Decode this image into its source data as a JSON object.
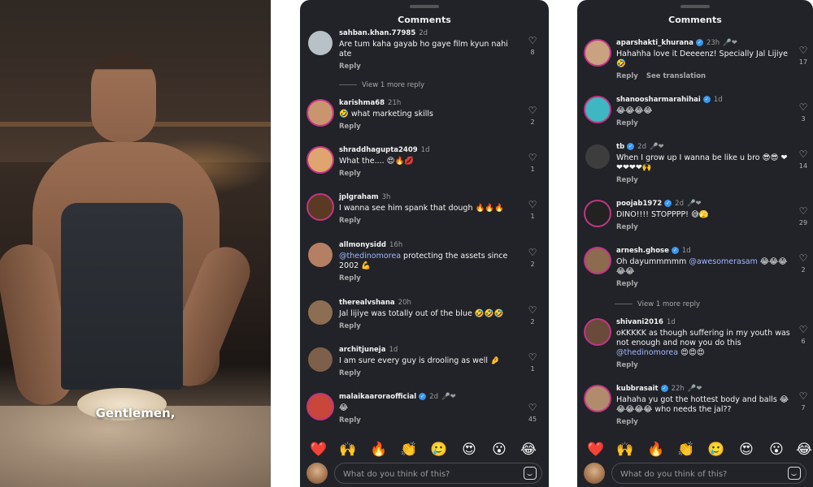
{
  "video": {
    "caption": "Gentlemen,"
  },
  "left_panel": {
    "title": "Comments",
    "comments": [
      {
        "user": "sahban.khan.77985",
        "time": "2d",
        "text": "Are tum kaha gayab ho gaye film kyun nahi ate",
        "reply": "Reply",
        "likes": "8",
        "avatar_color": "#b8c0c8"
      },
      {
        "user": "karishma68",
        "time": "21h",
        "text": "🤣 what marketing skills",
        "reply": "Reply",
        "likes": "2",
        "avatar_color": "#c9956f"
      },
      {
        "user": "shraddhagupta2409",
        "time": "1d",
        "text": "What the.... 😍🔥💋",
        "reply": "Reply",
        "likes": "1",
        "avatar_color": "#e0a46e"
      },
      {
        "user": "jplgraham",
        "time": "3h",
        "text": "I wanna see him spank that dough 🔥🔥🔥",
        "reply": "Reply",
        "likes": "1",
        "avatar_color": "#5a3a22"
      },
      {
        "user": "allmonysidd",
        "time": "16h",
        "mention": "@thedinomorea",
        "text": " protecting the assets since 2002 💪",
        "reply": "Reply",
        "likes": "2",
        "avatar_color": "#b57f63"
      },
      {
        "user": "therealvshana",
        "time": "20h",
        "text": "Jal lijiye was totally out of the blue 🤣🤣🤣",
        "reply": "Reply",
        "likes": "2",
        "avatar_color": "#8d6e53"
      },
      {
        "user": "architjuneja",
        "time": "1d",
        "text": "I am sure every guy is drooling as well 🤌",
        "reply": "Reply",
        "likes": "1",
        "avatar_color": "#7e5f4a"
      },
      {
        "user": "malaikaaroraofficial",
        "time": "2d",
        "badge": "🎤❤",
        "text": "😂",
        "reply": "Reply",
        "likes": "45",
        "avatar_color": "#c8463a"
      }
    ],
    "view_more": "View 1 more reply"
  },
  "right_panel": {
    "title": "Comments",
    "comments": [
      {
        "user": "aparshakti_khurana",
        "time": "23h",
        "badge": "🎤❤",
        "text": "Hahahha love it Deeeenz! Specially Jal Lijiye 🤣",
        "reply": "Reply",
        "translate": "See translation",
        "likes": "17",
        "avatar_color": "#c9a27f"
      },
      {
        "user": "shanoosharmarahihai",
        "time": "1d",
        "text": "😂😂😂😂",
        "reply": "Reply",
        "likes": "3",
        "avatar_color": "#3fb7c2"
      },
      {
        "user": "tb",
        "time": "2d",
        "badge": "🎤❤",
        "text": "When I grow up I wanna be like u bro 😎😎 ❤❤❤❤❤🙌",
        "reply": "Reply",
        "likes": "14",
        "avatar_color": "#3d3d3d"
      },
      {
        "user": "poojab1972",
        "time": "2d",
        "badge": "🎤❤",
        "text": "DINO!!!! STOPPPP! 😅🫣",
        "reply": "Reply",
        "likes": "29",
        "avatar_color": "#222222"
      },
      {
        "user": "arnesh.ghose",
        "time": "1d",
        "mention": "@awesomerasam",
        "text_before": "Oh dayummmmm ",
        "text": " 😂😂😂😂😂",
        "reply": "Reply",
        "likes": "2",
        "avatar_color": "#8c6b4f"
      },
      {
        "user": "shivani2016",
        "time": "1d",
        "mention": "@thedinomorea",
        "text_before": "oKKKKK as though suffering in my youth was not enough and now you do this ",
        "text": " 😍😍😍",
        "reply": "Reply",
        "likes": "6",
        "avatar_color": "#6a4a3a"
      },
      {
        "user": "kubbrasait",
        "time": "22h",
        "badge": "🎤❤",
        "text": "Hahaha yu got the hottest body and balls 😂😂😂😂😂 who needs the jal??",
        "reply": "Reply",
        "likes": "7",
        "avatar_color": "#b08c6c"
      }
    ],
    "view_more": "View 1 more reply"
  },
  "emoji_reactions": [
    "❤️",
    "🙌",
    "🔥",
    "👏",
    "🥲",
    "😍",
    "😮",
    "😂"
  ],
  "input": {
    "placeholder": "What do you think of this?"
  },
  "icons": {
    "like": "heart-icon",
    "sticker": "sticker-icon",
    "verified": "verified-badge-icon"
  }
}
